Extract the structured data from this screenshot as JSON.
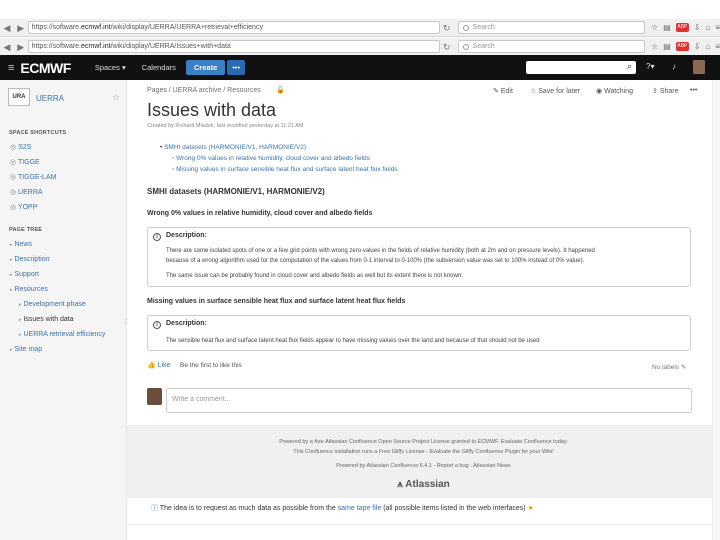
{
  "browser": {
    "row1": {
      "url_pre": "https://software.",
      "url_host": "ecmwf.int",
      "url_post": "/wiki/display/UERRA/UERRA+retrieval+efficiency",
      "search": "Search"
    },
    "row2": {
      "url_pre": "https://software.",
      "url_host": "ecmwf.int",
      "url_post": "/wiki/display/UERRA/Issues+with+data",
      "search": "Search"
    },
    "abp_label": "ABP"
  },
  "appbar": {
    "logo": "ECMWF",
    "spaces": "Spaces",
    "calendars": "Calendars",
    "create": "Create",
    "more": "•••"
  },
  "sidebar": {
    "space_name": "UERRA",
    "shortcuts_title": "SPACE SHORTCUTS",
    "shortcuts": [
      "S2S",
      "TIGGE",
      "TIGGE-LAM",
      "UERRA",
      "YOPP"
    ],
    "tree_title": "PAGE TREE",
    "tree": [
      {
        "label": "News",
        "depth": 0
      },
      {
        "label": "Description",
        "depth": 0
      },
      {
        "label": "Support",
        "depth": 0
      },
      {
        "label": "Resources",
        "depth": 0
      },
      {
        "label": "Development phase",
        "depth": 1
      },
      {
        "label": "Issues with data",
        "depth": 1
      },
      {
        "label": "UERRA retrieval efficiency",
        "depth": 1
      },
      {
        "label": "Site map",
        "depth": 0
      }
    ]
  },
  "page": {
    "breadcrumbs": "Pages / UERRA archive / Resources",
    "actions": {
      "edit": "Edit",
      "save": "Save for later",
      "watch": "Watching",
      "share": "Share"
    },
    "title": "Issues with data",
    "meta": "Created by Richard Mladek, last modified yesterday at 11:21 AM",
    "toc": [
      {
        "label": "SMHI datasets (HARMONIE/V1, HARMONIE/V2)",
        "depth": 0
      },
      {
        "label": "Wrong 0% values in relative humidity, cloud cover and albedo fields",
        "depth": 1
      },
      {
        "label": "Missing values in surface sensible heat flux and surface latent heat flux fields",
        "depth": 1
      }
    ],
    "section_title": "SMHI datasets (HARMONIE/V1, HARMONIE/V2)",
    "issue1": {
      "title": "Wrong 0% values in relative humidity, cloud cover and albedo fields",
      "panel_head": "Description:",
      "text1": "There are some isolated spots of one or a few grid points with wrong zero values in the fields of relative humidity (both at 2m and on pressure levels). It happened",
      "text2": "because of a wrong algorithm used for the computation of the values from 0-1 interval to 0-100% (the subversion value was set to 100% instead of 0% value).",
      "text3": "The same issue can be probably found in cloud cover and albedo fields as well but its extent there is not known."
    },
    "issue2": {
      "title": "Missing values in surface sensible heat flux and surface latent heat flux fields",
      "panel_head": "Description:",
      "text1": "The sensible heat flux and surface latent heat flux fields appear to have missing values over the land and because of that should not be used"
    },
    "like": "Like",
    "like_text": "Be the first to like this",
    "no_labels": "No labels",
    "comment_placeholder": "Write a comment...",
    "footer": {
      "line1": "Powered by a free Atlassian Confluence Open Source Project License granted to ECMWF. Evaluate Confluence today.",
      "line2": "This Confluence installation runs a Free Gliffy License - Evaluate the Gliffy Confluence Plugin for your Wiki!",
      "line3": "Powered by Atlassian Confluence 6.4.1 · Report a bug · Atlassian News",
      "atlassian": "Atlassian"
    },
    "slide_text_pre": "The idea is to request as much data as possible from the",
    "slide_link": "same tape file",
    "slide_text_post": "(all possible items listed in the web interfaces)"
  }
}
